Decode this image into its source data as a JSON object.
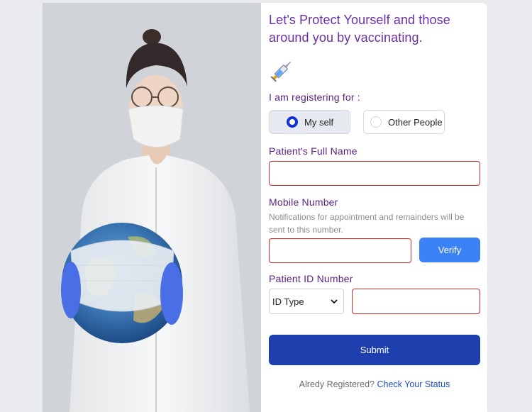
{
  "form": {
    "title_line1": "Let's Protect Yourself and those",
    "title_line2": "around you by vaccinating.",
    "registering_label": "I am registering for :",
    "options": [
      {
        "label": "My self",
        "selected": true
      },
      {
        "label": "Other People",
        "selected": false
      }
    ],
    "full_name_label": "Patient's Full Name",
    "full_name_value": "",
    "mobile_label": "Mobile Number",
    "mobile_hint": "Notifications for appointment and remainders will be sent to this number.",
    "mobile_value": "",
    "verify_label": "Verify",
    "patient_id_label": "Patient ID Number",
    "id_type_selected": "ID Type",
    "id_value": "",
    "submit_label": "Submit",
    "footer_text": "Alredy Registered?",
    "footer_link": "Check Your Status"
  },
  "colors": {
    "title": "#6b2fa3",
    "label": "#5b2384",
    "error_border": "#cc2a2a",
    "verify_bg": "#3b82f6",
    "submit_bg": "#1e40af",
    "radio_on": "#1433d6",
    "link": "#1e4fc0"
  },
  "icons": {
    "illustration": "syringe-icon"
  }
}
